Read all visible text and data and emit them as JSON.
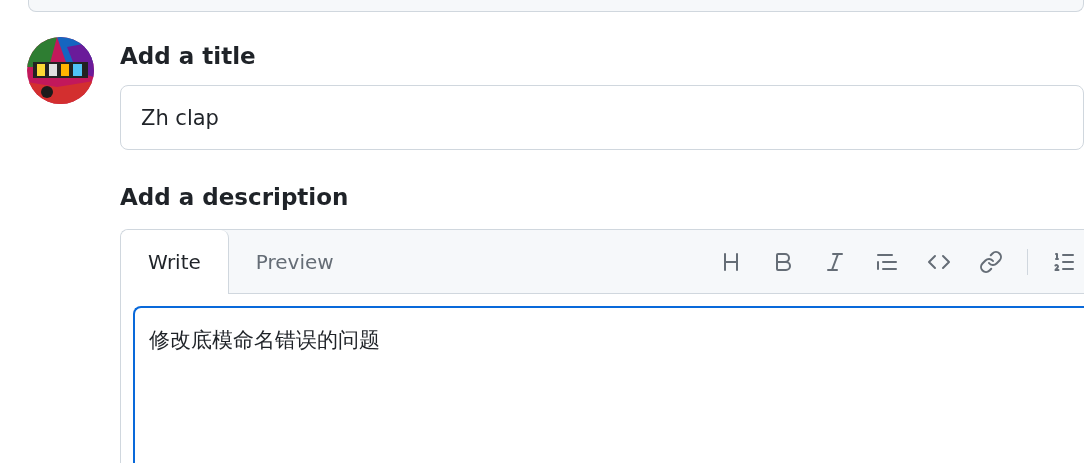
{
  "title_field": {
    "label": "Add a title",
    "value": "Zh clap"
  },
  "description": {
    "label": "Add a description",
    "tabs": [
      {
        "label": "Write",
        "selected": true
      },
      {
        "label": "Preview",
        "selected": false
      }
    ],
    "value": "修改底模命名错误的问题"
  }
}
